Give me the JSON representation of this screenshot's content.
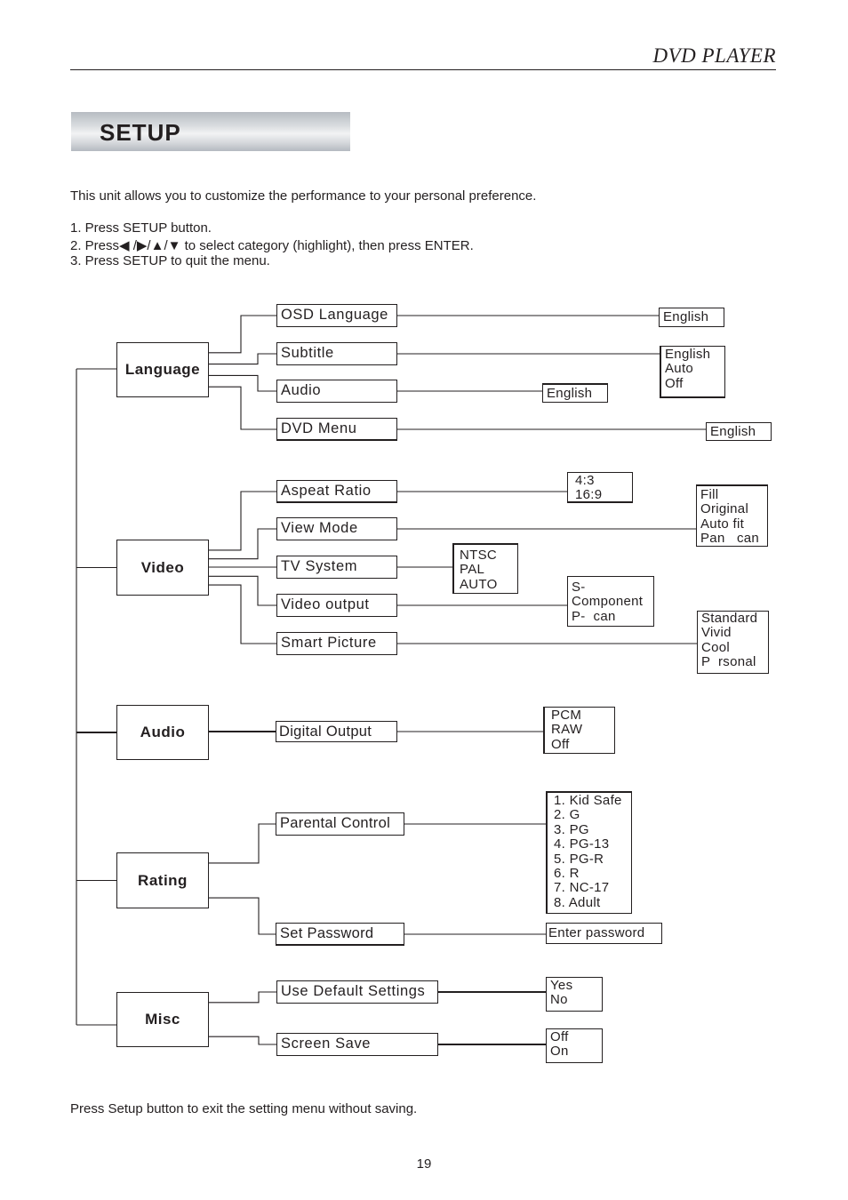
{
  "header": {
    "title": "DVD PLAYER"
  },
  "section": {
    "title": "SETUP"
  },
  "intro": {
    "text": "This unit allows you to customize the performance to your personal preference.",
    "steps": [
      "1. Press SETUP button.",
      "2. Press◀ /▶/▲/▼ to select category (highlight), then press ENTER.",
      "3. Press SETUP to quit the menu."
    ]
  },
  "menu_tree": {
    "categories": [
      {
        "label": "Language",
        "items": [
          {
            "label": "OSD Language",
            "options": [
              "English"
            ]
          },
          {
            "label": "Subtitle",
            "options": [
              "English",
              "Auto",
              "Off"
            ]
          },
          {
            "label": "Audio",
            "options": [
              "English"
            ]
          },
          {
            "label": "DVD Menu",
            "options": [
              "English"
            ]
          }
        ]
      },
      {
        "label": "Video",
        "items": [
          {
            "label": "Aspeat Ratio",
            "options": [
              "4:3",
              "16:9"
            ]
          },
          {
            "label": "View Mode",
            "options": [
              "Fill",
              "Original",
              "Auto fit",
              "Pan   can"
            ]
          },
          {
            "label": "TV System",
            "options": [
              "NTSC",
              "PAL",
              "AUTO"
            ]
          },
          {
            "label": "Video output",
            "options": [
              "S-",
              "Component",
              "P-  can"
            ]
          },
          {
            "label": "Smart Picture",
            "options": [
              "Standard",
              "Vivid",
              "Cool",
              "P  rsonal"
            ]
          }
        ]
      },
      {
        "label": "Audio",
        "items": [
          {
            "label": "Digital Output",
            "options": [
              "PCM",
              "RAW",
              "Off"
            ]
          }
        ]
      },
      {
        "label": "Rating",
        "items": [
          {
            "label": "Parental Control",
            "options": [
              "1. Kid Safe",
              "2. G",
              "3. PG",
              "4. PG-13",
              "5. PG-R",
              "6. R",
              "7. NC-17",
              "8. Adult"
            ]
          },
          {
            "label": "Set Password",
            "options": [
              "Enter password"
            ]
          }
        ]
      },
      {
        "label": "Misc",
        "items": [
          {
            "label": "Use Default Settings",
            "options": [
              "Yes",
              "No"
            ]
          },
          {
            "label": "Screen Save",
            "options": [
              "Off",
              "On"
            ]
          }
        ]
      }
    ]
  },
  "footer": {
    "note": "Press Setup button to exit the setting menu without saving.",
    "page_number": "19"
  }
}
